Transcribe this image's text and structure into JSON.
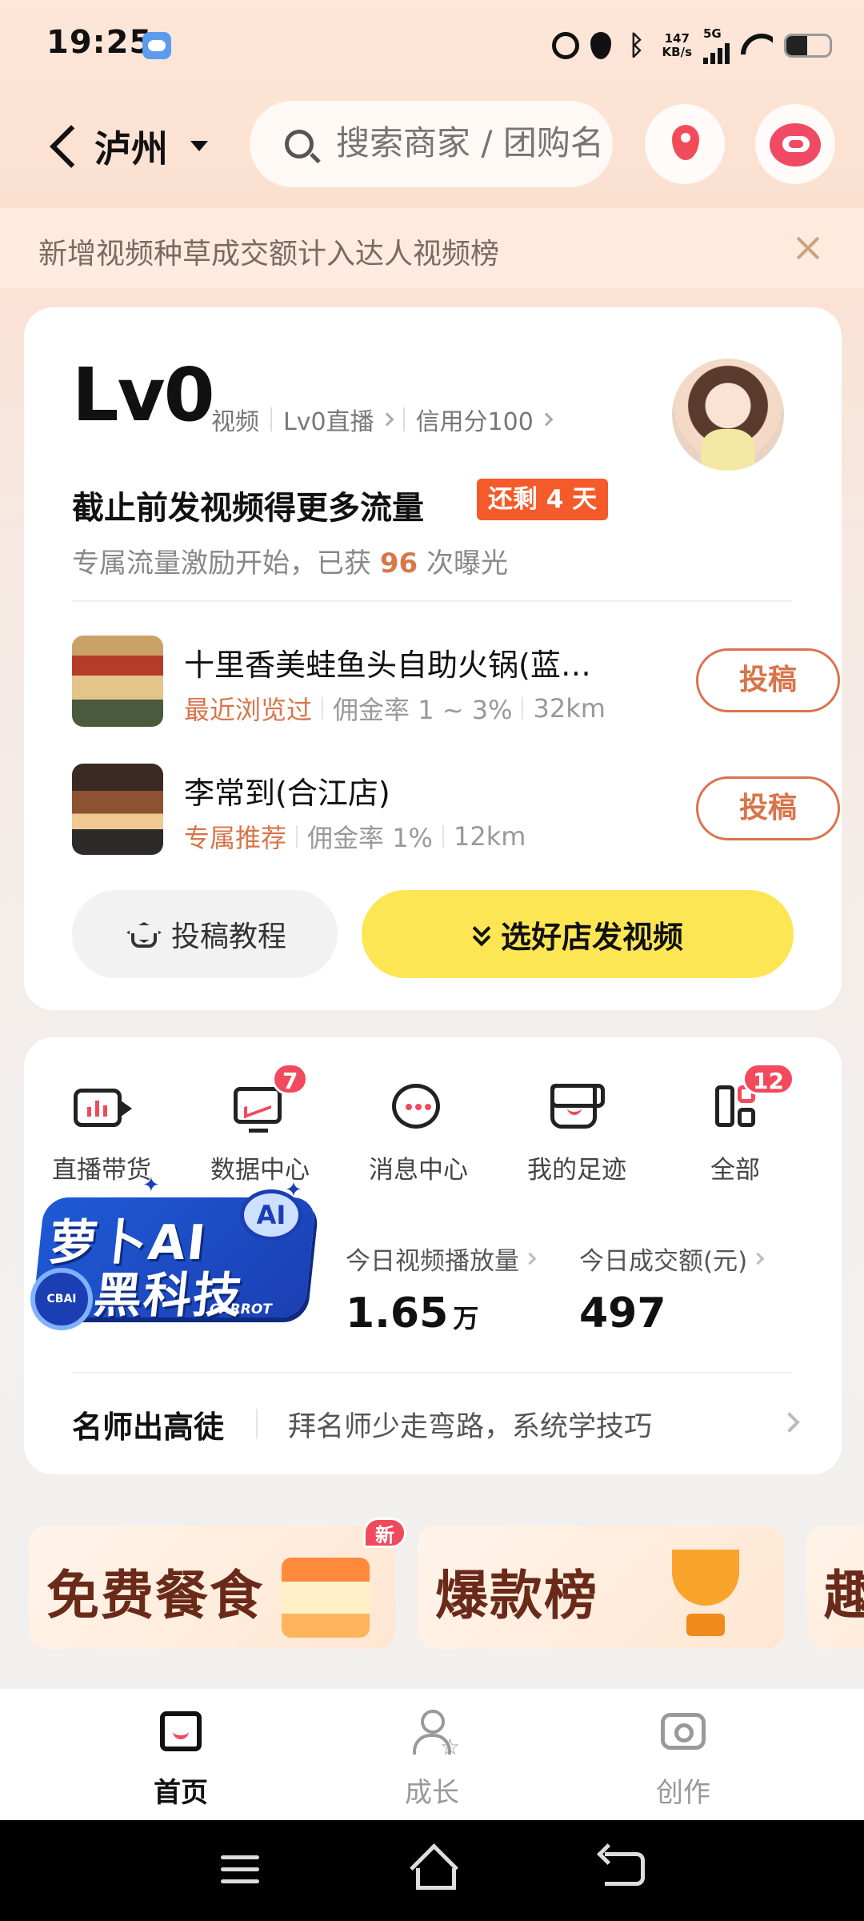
{
  "status_bar": {
    "time": "19:25",
    "net_speed_value": "147",
    "net_speed_unit": "KB/s",
    "network_type": "5G",
    "bluetooth_glyph": "ᛒ"
  },
  "header": {
    "city": "泸州",
    "search_placeholder": "搜索商家 / 团购名",
    "map_icon": "map-pin-icon",
    "mascot_icon": "mascot-icon"
  },
  "notice": {
    "text": "新增视频种草成交额计入达人视频榜"
  },
  "profile": {
    "level": "Lv0",
    "link_video": "视频",
    "link_live": "Lv0直播",
    "link_credit": "信用分100",
    "headline": "截止前发视频得更多流量",
    "deadline_badge": "还剩 4 天",
    "sub_prefix": "专属流量激励开始，已获 ",
    "sub_count": "96",
    "sub_suffix": " 次曝光"
  },
  "shops": [
    {
      "name": "十里香美蛙鱼头自助火锅(蓝…",
      "tag": "最近浏览过",
      "commission": "佣金率 1 ~ 3%",
      "distance": "32km",
      "button": "投稿"
    },
    {
      "name": "李常到(合江店)",
      "tag": "专属推荐",
      "commission": "佣金率 1%",
      "distance": "12km",
      "button": "投稿"
    }
  ],
  "actions": {
    "tutorial": "投稿教程",
    "select_shop": "选好店发视频"
  },
  "tools": [
    {
      "label": "直播带货",
      "icon": "live-sales-icon",
      "badge": ""
    },
    {
      "label": "数据中心",
      "icon": "data-center-icon",
      "badge": "7"
    },
    {
      "label": "消息中心",
      "icon": "message-center-icon",
      "badge": ""
    },
    {
      "label": "我的足迹",
      "icon": "footprint-icon",
      "badge": ""
    },
    {
      "label": "全部",
      "icon": "all-apps-icon",
      "badge": "12"
    }
  ],
  "promo": {
    "line1": "萝卜AI",
    "line2": "黑科技",
    "ai_mark": "AI",
    "disc_text": "CBAI",
    "brand": "CARROT"
  },
  "stats": {
    "views_label": "今日视频播放量",
    "views_value": "1.65",
    "views_unit": "万",
    "gmv_label": "今日成交额(元)",
    "gmv_value": "497"
  },
  "mentor": {
    "title": "名师出高徒",
    "desc": "拜名师少走弯路，系统学技巧"
  },
  "banners": [
    {
      "text": "免费餐食",
      "badge": "新"
    },
    {
      "text": "爆款榜",
      "badge": ""
    },
    {
      "text": "趣",
      "badge": ""
    }
  ],
  "bottom_nav": [
    {
      "label": "首页",
      "icon": "home-bag-icon",
      "active": true
    },
    {
      "label": "成长",
      "icon": "growth-icon",
      "active": false
    },
    {
      "label": "创作",
      "icon": "camera-icon",
      "active": false
    }
  ],
  "colors": {
    "accent_orange": "#d9744a",
    "badge_red": "#f04a5c",
    "cta_yellow": "#fde653",
    "deadline_red": "#f45a2a"
  }
}
